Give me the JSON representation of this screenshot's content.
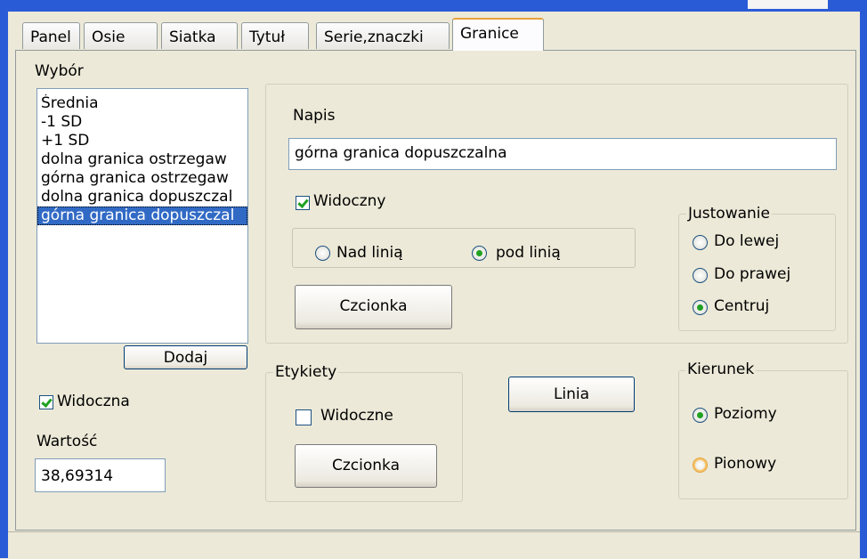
{
  "tabs": [
    {
      "label": "Panel"
    },
    {
      "label": "Osie"
    },
    {
      "label": "Siatka"
    },
    {
      "label": "Tytuł"
    },
    {
      "label": "Serie,znaczki"
    },
    {
      "label": "Granice"
    }
  ],
  "selection": {
    "group_label": "Wybór",
    "items": [
      {
        "label": "Średnia"
      },
      {
        "label": "-1 SD"
      },
      {
        "label": "+1 SD"
      },
      {
        "label": "dolna granica ostrzegaw"
      },
      {
        "label": "górna granica ostrzegaw"
      },
      {
        "label": "dolna granica dopuszczal"
      },
      {
        "label": "górna granica dopuszczal"
      }
    ],
    "add_label": "Dodaj",
    "visible_label": "Widoczna",
    "value_label": "Wartość",
    "value": "38,69314"
  },
  "caption": {
    "label": "Napis",
    "value": "górna granica dopuszczalna",
    "visible_label": "Widoczny",
    "above_label": "Nad linią",
    "below_label": "pod linią",
    "font_label": "Czcionka"
  },
  "justify": {
    "legend": "Justowanie",
    "left": "Do lewej",
    "right": "Do prawej",
    "center": "Centruj"
  },
  "labels": {
    "legend": "Etykiety",
    "visible_label": "Widoczne",
    "font_label": "Czcionka"
  },
  "line_button": "Linia",
  "direction": {
    "legend": "Kierunek",
    "horizontal": "Poziomy",
    "vertical": "Pionowy"
  },
  "colors": {
    "accent": "#21a121",
    "title_blue": "#2a5bd7",
    "selection": "#316ac5"
  }
}
